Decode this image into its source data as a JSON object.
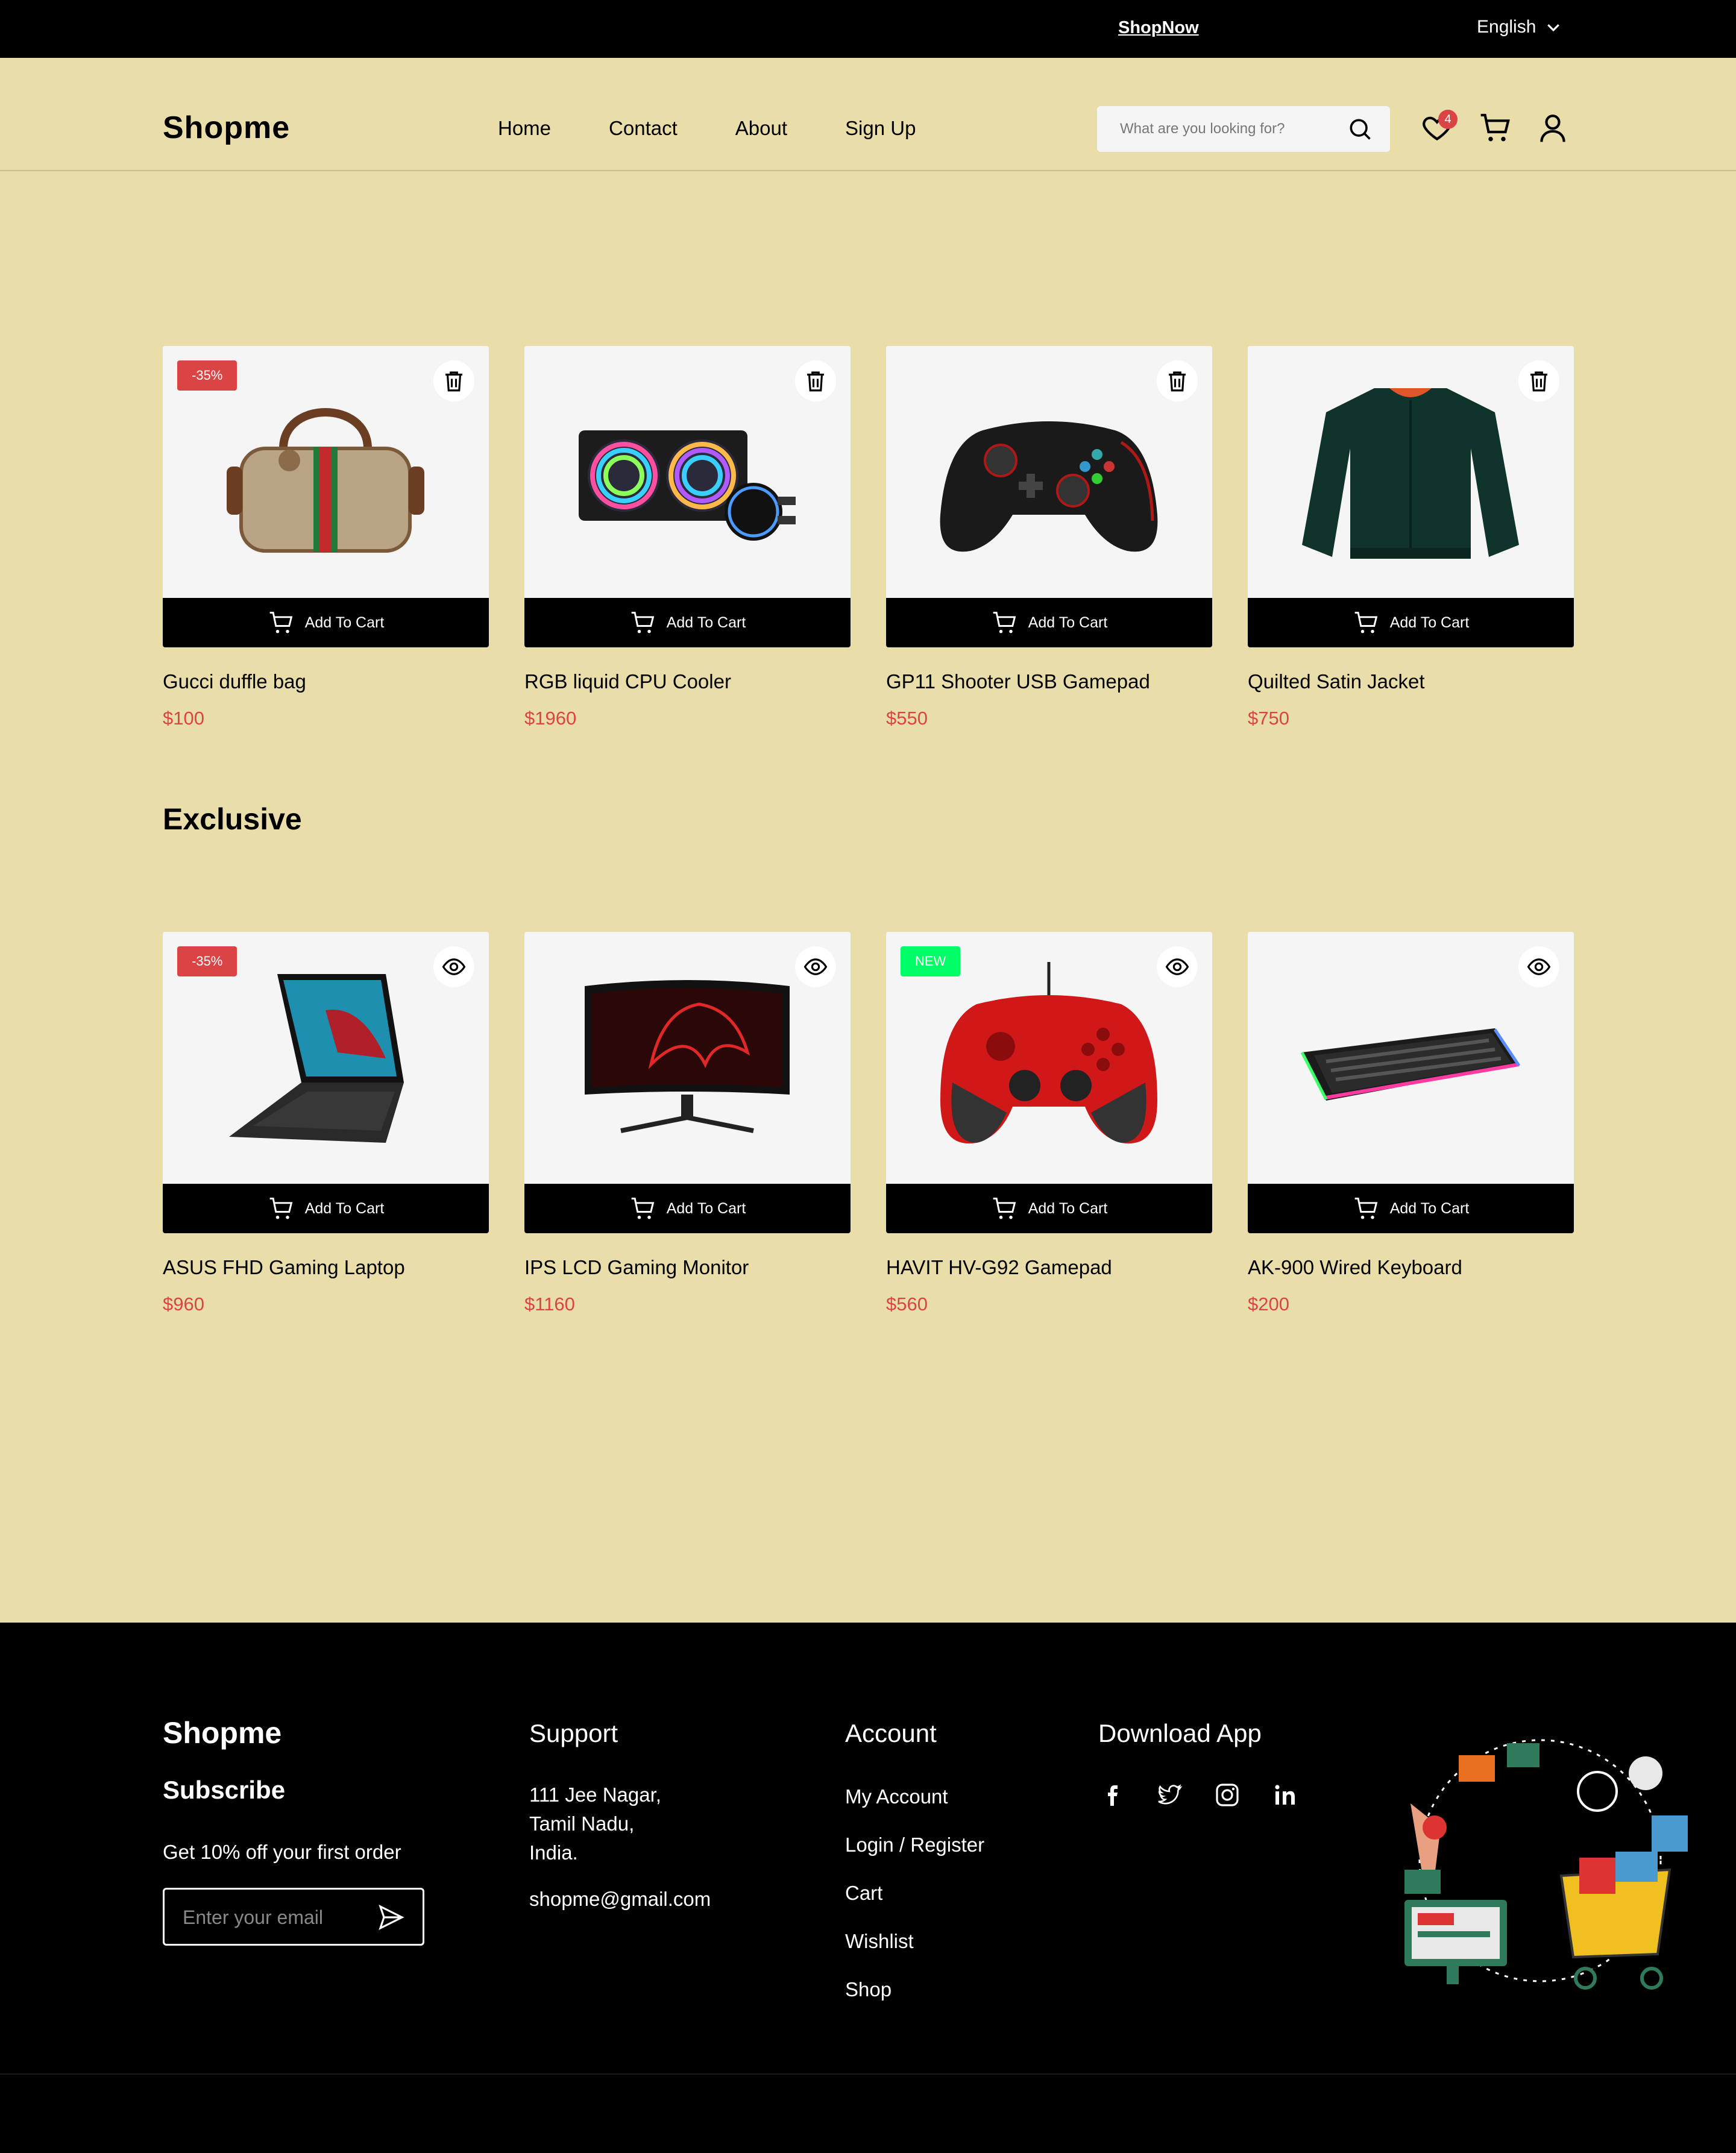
{
  "topbar": {
    "promo": "ShopNow",
    "language": "English"
  },
  "header": {
    "logo": "Shopme",
    "nav": [
      "Home",
      "Contact",
      "About",
      "Sign Up"
    ],
    "search_placeholder": "What are you looking for?",
    "wishlist_count": "4"
  },
  "wishlist": {
    "items": [
      {
        "name": "Gucci duffle bag",
        "price": "$100",
        "tag": "-35%",
        "action": "Add To Cart"
      },
      {
        "name": "RGB liquid CPU Cooler",
        "price": "$1960",
        "action": "Add To Cart"
      },
      {
        "name": "GP11 Shooter USB Gamepad",
        "price": "$550",
        "action": "Add To Cart"
      },
      {
        "name": "Quilted Satin Jacket",
        "price": "$750",
        "action": "Add To Cart"
      }
    ]
  },
  "exclusive": {
    "title": "Exclusive",
    "items": [
      {
        "name": "ASUS FHD Gaming Laptop",
        "price": "$960",
        "tag": "-35%",
        "action": "Add To Cart"
      },
      {
        "name": "IPS LCD Gaming Monitor",
        "price": "$1160",
        "action": "Add To Cart"
      },
      {
        "name": "HAVIT HV-G92 Gamepad",
        "price": "$560",
        "tag": "NEW",
        "action": "Add To Cart"
      },
      {
        "name": "AK-900 Wired Keyboard",
        "price": "$200",
        "action": "Add To Cart"
      }
    ]
  },
  "colors": {
    "accent": "#db4444",
    "new_tag": "#00ff66",
    "background": "#e9dea9",
    "dark": "#000000"
  },
  "footer": {
    "logo": "Shopme",
    "subscribe": "Subscribe",
    "offer": "Get 10% off your first order",
    "email_placeholder": "Enter your email",
    "support": {
      "title": "Support",
      "address": [
        "111 Jee Nagar,",
        "Tamil Nadu,",
        "India."
      ],
      "email": "shopme@gmail.com"
    },
    "account": {
      "title": "Account",
      "links": [
        "My Account",
        "Login / Register",
        "Cart",
        "Wishlist",
        "Shop"
      ]
    },
    "download": {
      "title": "Download App",
      "social": [
        "facebook-icon",
        "twitter-icon",
        "instagram-icon",
        "linkedin-icon"
      ]
    }
  }
}
